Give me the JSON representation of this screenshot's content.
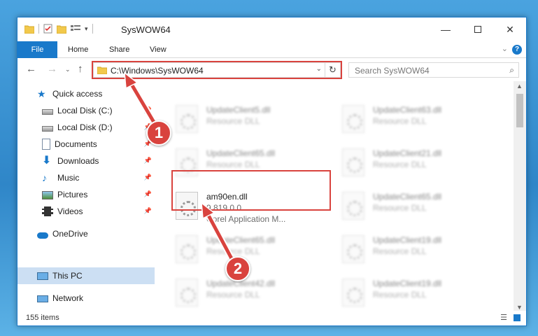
{
  "window": {
    "title": "SysWOW64"
  },
  "ribbon": {
    "file": "File",
    "home": "Home",
    "share": "Share",
    "view": "View"
  },
  "address": {
    "path": "C:\\Windows\\SysWOW64",
    "search_placeholder": "Search SysWOW64"
  },
  "sidebar": {
    "items": [
      {
        "label": "Quick access",
        "icon": "star-icon",
        "pinned": false
      },
      {
        "label": "Local Disk (C:)",
        "icon": "drive-icon",
        "pinned": true
      },
      {
        "label": "Local Disk (D:)",
        "icon": "drive-icon",
        "pinned": true
      },
      {
        "label": "Documents",
        "icon": "documents-icon",
        "pinned": true
      },
      {
        "label": "Downloads",
        "icon": "download-icon",
        "pinned": true
      },
      {
        "label": "Music",
        "icon": "music-icon",
        "pinned": true
      },
      {
        "label": "Pictures",
        "icon": "pictures-icon",
        "pinned": true
      },
      {
        "label": "Videos",
        "icon": "videos-icon",
        "pinned": true
      },
      {
        "label": "OneDrive",
        "icon": "cloud-icon",
        "pinned": false
      },
      {
        "label": "This PC",
        "icon": "computer-icon",
        "pinned": false,
        "selected": true
      },
      {
        "label": "Network",
        "icon": "network-icon",
        "pinned": false
      }
    ]
  },
  "files": {
    "left": [
      {
        "name": "UpdateClient5.dll",
        "desc": "Resource DLL"
      },
      {
        "name": "UpdateClient65.dll",
        "desc": "Resource DLL"
      },
      {
        "name": "UpdateClient65.dll",
        "desc": "Resource DLL"
      },
      {
        "name": "UpdateClient42.dll",
        "desc": "Resource DLL"
      }
    ],
    "right": [
      {
        "name": "UpdateClient63.dll",
        "desc": "Resource DLL"
      },
      {
        "name": "UpdateClient21.dll",
        "desc": "Resource DLL"
      },
      {
        "name": "UpdateClient65.dll",
        "desc": "Resource DLL"
      },
      {
        "name": "UpdateClient19.dll",
        "desc": "Resource DLL"
      },
      {
        "name": "UpdateClient19.dll",
        "desc": "Resource DLL"
      }
    ],
    "highlighted": {
      "name": "am90en.dll",
      "version": "9.819.0.0",
      "company": "Corel Application M..."
    }
  },
  "status": {
    "count": "155 items"
  },
  "annotations": {
    "step1": "1",
    "step2": "2",
    "color": "#d9433e"
  }
}
